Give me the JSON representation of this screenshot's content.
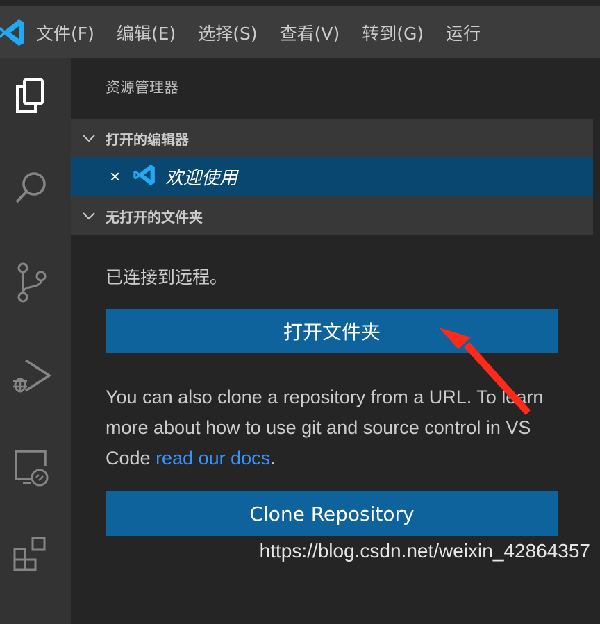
{
  "menu": {
    "items": [
      "文件(F)",
      "编辑(E)",
      "选择(S)",
      "查看(V)",
      "转到(G)",
      "运行"
    ]
  },
  "activity": {
    "icons": [
      "explorer-icon",
      "search-icon",
      "source-control-icon",
      "run-debug-icon",
      "remote-explorer-icon",
      "extensions-icon"
    ]
  },
  "sidebar": {
    "title": "资源管理器",
    "open_editors": {
      "header": "打开的编辑器",
      "items": [
        {
          "label": "欢迎使用",
          "close": "×"
        }
      ]
    },
    "no_folder": {
      "header": "无打开的文件夹",
      "message": "已连接到远程。",
      "open_folder_label": "打开文件夹",
      "help_text": "You can also clone a repository from a URL. To learn more about how to use git and source control in VS Code ",
      "docs_link": "read our docs",
      "help_end": ".",
      "clone_label": "Clone Repository"
    }
  },
  "watermark": "https://blog.csdn.net/weixin_42864357",
  "colors": {
    "accent": "#0e639c",
    "selection": "#094771",
    "link": "#3794ff",
    "arrow": "#ff2a1a"
  }
}
